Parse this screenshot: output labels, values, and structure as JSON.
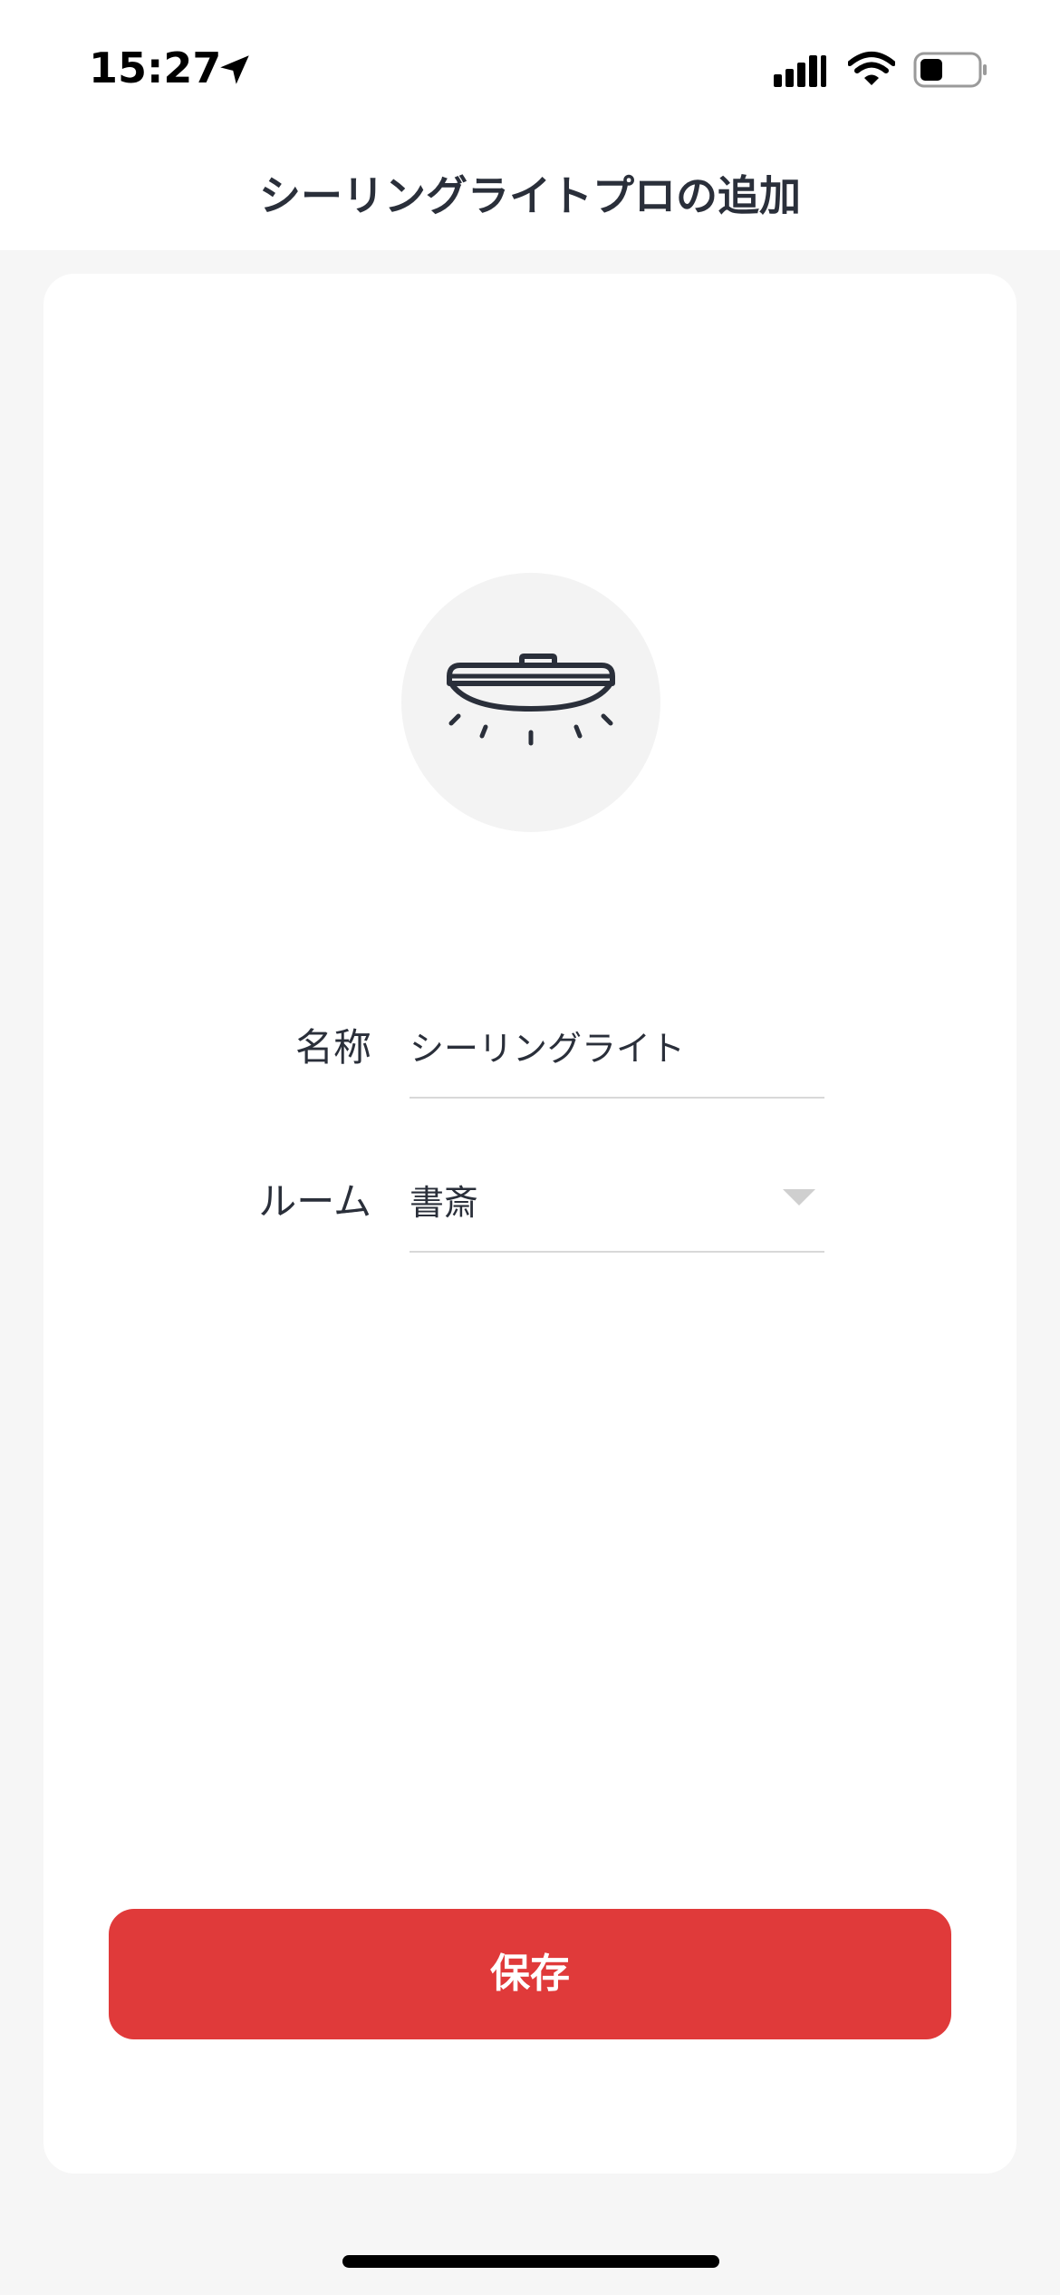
{
  "status_bar": {
    "time": "15:27",
    "icons": [
      "location-arrow-icon",
      "cellular-signal-icon",
      "wifi-icon",
      "battery-icon"
    ],
    "battery_level": 0.35
  },
  "header": {
    "title": "シーリングライトプロの追加"
  },
  "device": {
    "icon": "ceiling-light-icon"
  },
  "form": {
    "name_label": "名称",
    "name_value": "シーリングライト",
    "room_label": "ルーム",
    "room_value": "書斎",
    "room_dropdown_icon": "caret-down-icon"
  },
  "actions": {
    "save_label": "保存"
  },
  "colors": {
    "accent": "#e03a3a",
    "background": "#f6f6f6",
    "card": "#ffffff",
    "text": "#2a2f3a"
  }
}
